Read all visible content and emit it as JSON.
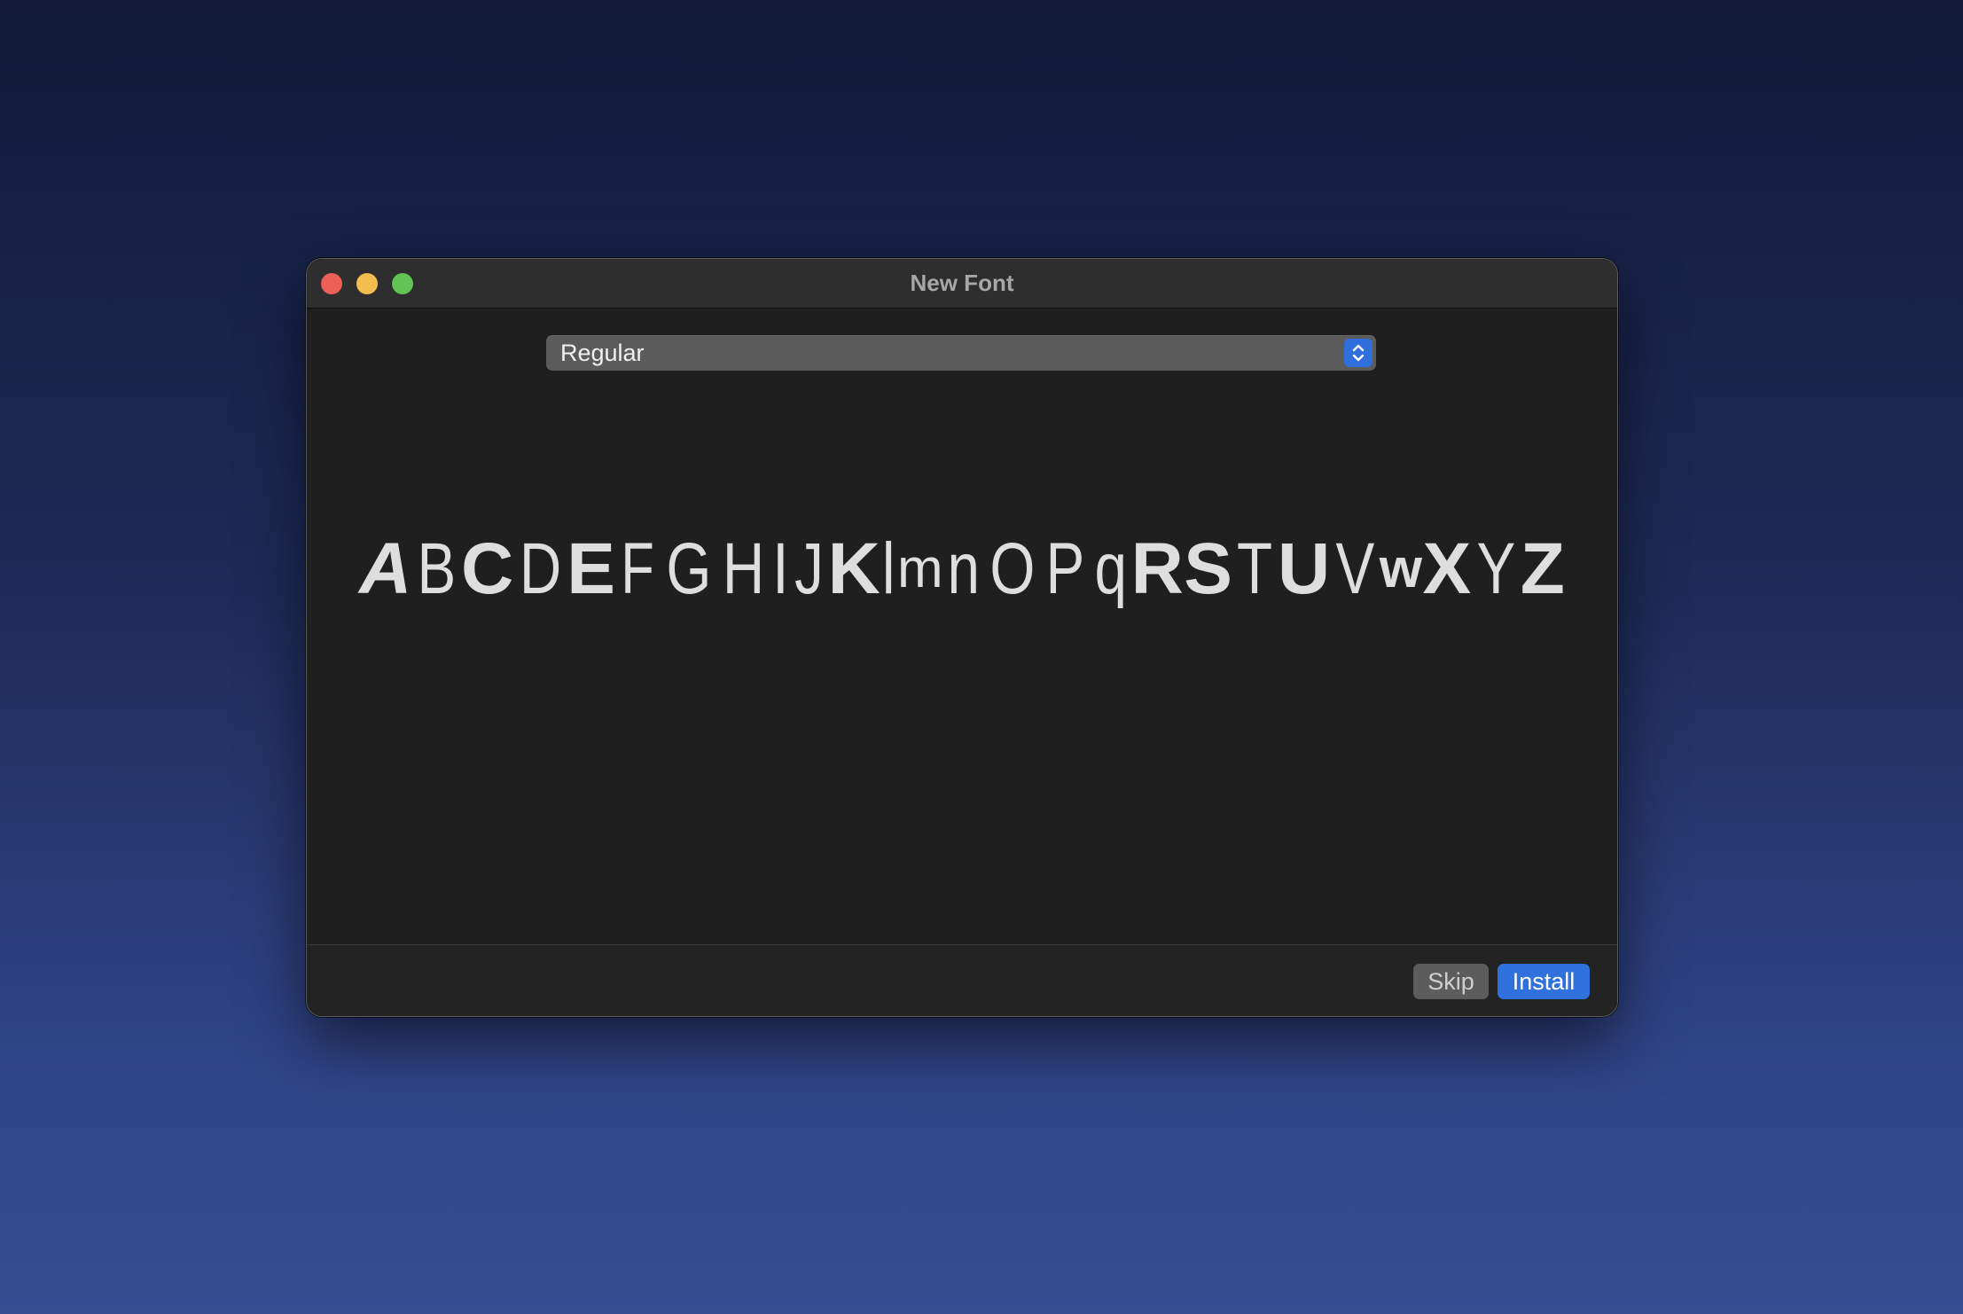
{
  "window": {
    "title": "New Font"
  },
  "style_select": {
    "value": "Regular"
  },
  "preview": {
    "glyphs": [
      "A",
      "B",
      "C",
      "D",
      "E",
      "F",
      "G",
      "H",
      "I",
      "J",
      "K",
      "l",
      "m",
      "n",
      "O",
      "P",
      "q",
      "R",
      "S",
      "T",
      "U",
      "V",
      "w",
      "X",
      "Y",
      "Z"
    ]
  },
  "footer": {
    "skip_label": "Skip",
    "install_label": "Install"
  },
  "colors": {
    "window_bg": "#1f1f1f",
    "accent": "#2f72dd",
    "close": "#ec5f57",
    "minimize": "#f4bd4f",
    "maximize": "#61c454"
  }
}
